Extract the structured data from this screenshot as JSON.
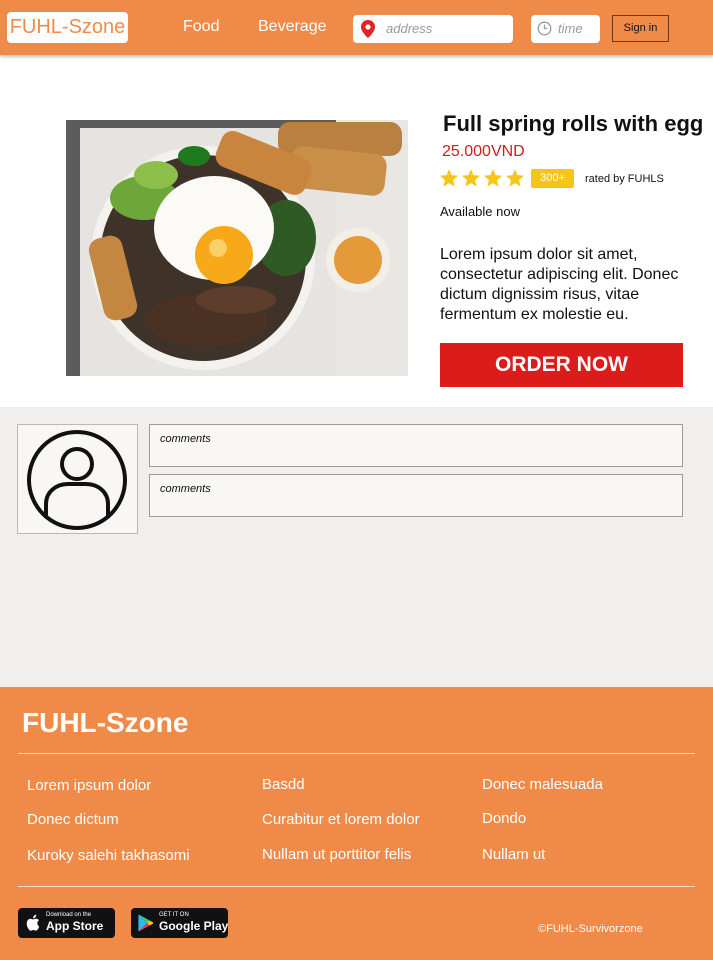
{
  "header": {
    "logo": "FUHL-Szone",
    "nav": [
      "Food",
      "Beverage"
    ],
    "address_placeholder": "address",
    "time_placeholder": "time",
    "signin_label": "Sign in",
    "icons": [
      "location-pin-icon",
      "clock-icon"
    ]
  },
  "product": {
    "image": "spring-rolls-egg-bowl-photo",
    "title": "Full spring rolls with egg",
    "price": "25.000VND",
    "rating": 4,
    "rating_max": 4,
    "rating_count": "300+",
    "rated_by": "rated by FUHLS",
    "availability": "Available now",
    "description": "Lorem ipsum dolor sit amet, consectetur adipiscing elit. Donec dictum dignissim risus, vitae fermentum ex molestie eu.",
    "order_label": "ORDER NOW"
  },
  "comments": {
    "items": [
      "comments",
      "comments"
    ]
  },
  "footer": {
    "brand": "FUHL-Szone",
    "columns": [
      [
        "Lorem ipsum dolor",
        "Donec dictum",
        "Kuroky salehi takhasomi"
      ],
      [
        "Basdd",
        "Curabitur et lorem dolor",
        "Nullam ut porttitor felis"
      ],
      [
        "Donec malesuada",
        "Dondo",
        "Nullam ut"
      ]
    ],
    "app_store": {
      "small": "Download on the",
      "big": "App Store"
    },
    "google_play": {
      "small": "GET IT ON",
      "big": "Google Play"
    },
    "copyright": "©FUHL-Survivorzone"
  },
  "colors": {
    "brand_orange": "#f08a48",
    "order_red": "#dc1b1b",
    "price_red": "#d21b1b",
    "star_yellow": "#f5c518"
  }
}
